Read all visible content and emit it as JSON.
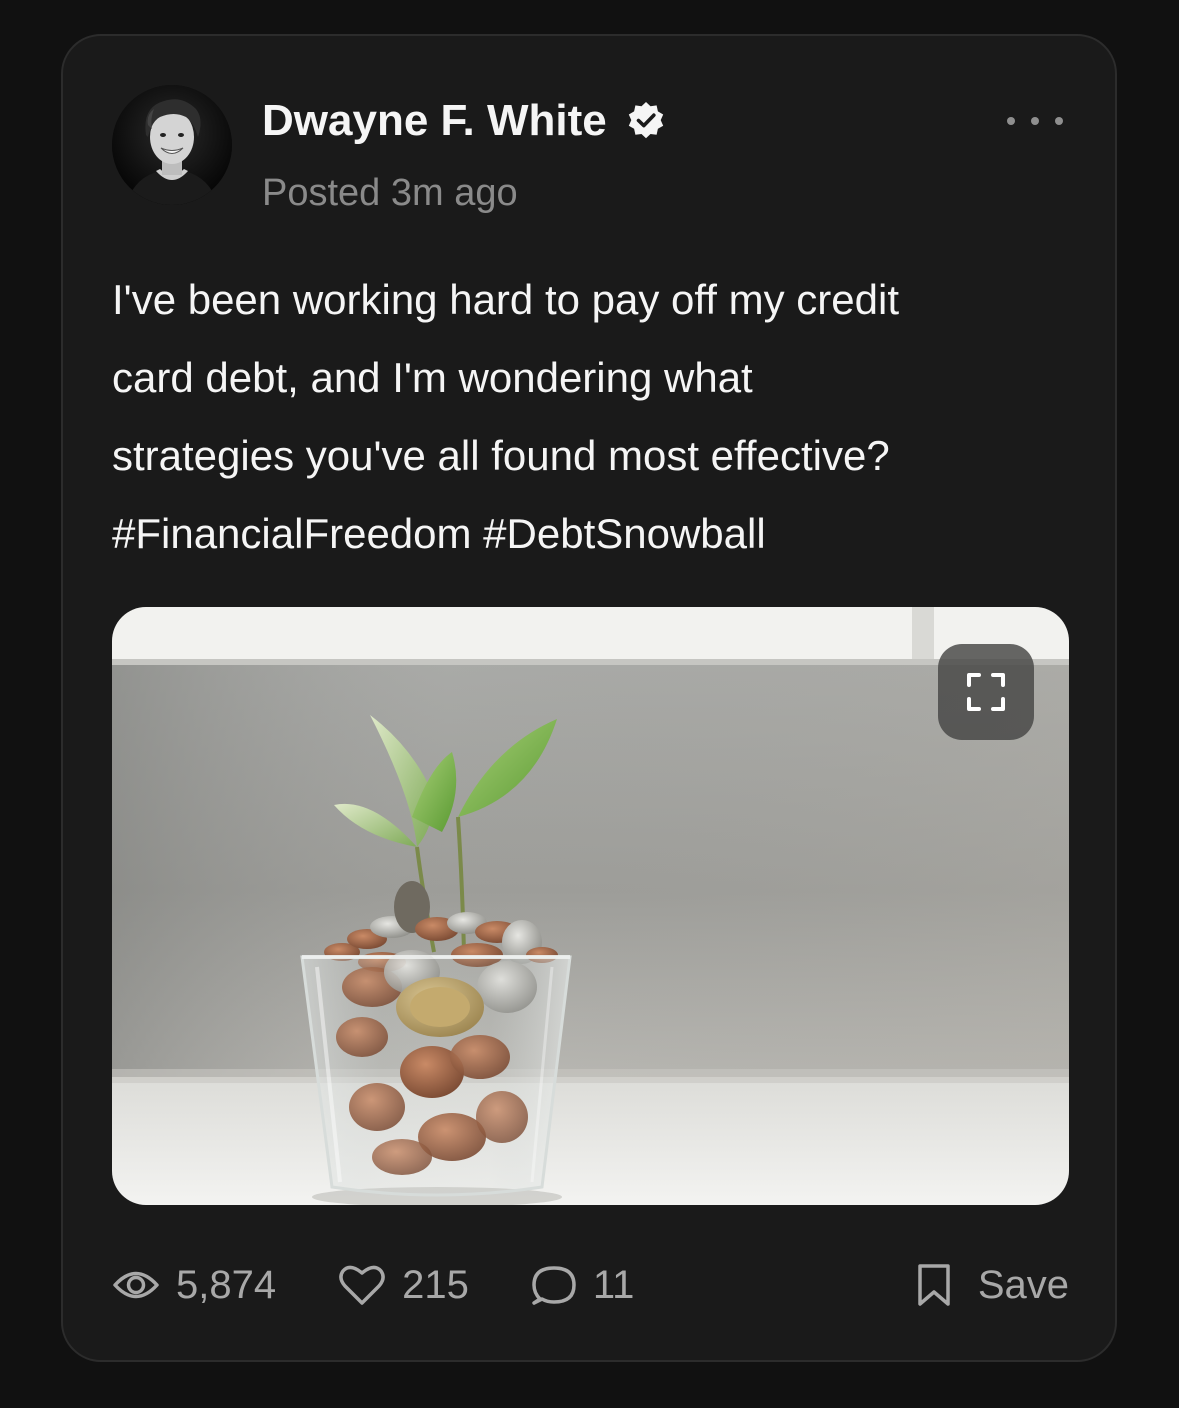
{
  "post": {
    "author_name": "Dwayne F. White",
    "verified": true,
    "posted_time": "Posted 3m ago",
    "text_lines": [
      "I've been working hard to pay off my credit",
      "card debt, and I'm wondering what",
      "strategies you've all found most effective?"
    ],
    "hashtags": "#FinancialFreedom #DebtSnowball",
    "image_alt": "Plant sprouting from glass of coins"
  },
  "stats": {
    "views": "5,874",
    "likes": "215",
    "comments": "11",
    "save_label": "Save"
  },
  "icons": {
    "more": "more-horizontal-icon",
    "verified": "verified-badge-icon",
    "expand": "expand-icon",
    "views": "eye-icon",
    "likes": "heart-icon",
    "comments": "comment-bubble-icon",
    "save": "bookmark-icon"
  },
  "colors": {
    "background": "#111111",
    "card": "#1a1a1a",
    "text_primary": "#f5f5f5",
    "text_secondary": "#8a8a8a",
    "stat_text": "#a8a8a8"
  }
}
